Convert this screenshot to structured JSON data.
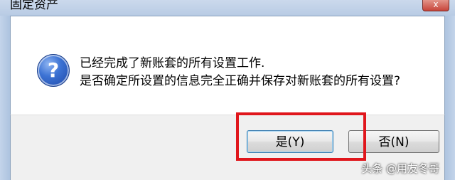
{
  "window": {
    "title": "固定资产",
    "close_glyph": "x"
  },
  "message": {
    "icon_glyph": "?",
    "line1": "已经完成了新账套的所有设置工作.",
    "line2": "是否确定所设置的信息完全正确并保存对新账套的所有设置?"
  },
  "buttons": {
    "yes_label": "是(Y)",
    "no_label": "否(N)"
  },
  "watermark": "头条 @用友冬哥",
  "colors": {
    "highlight_border": "#e0161c",
    "icon_blue": "#3d73d4"
  }
}
